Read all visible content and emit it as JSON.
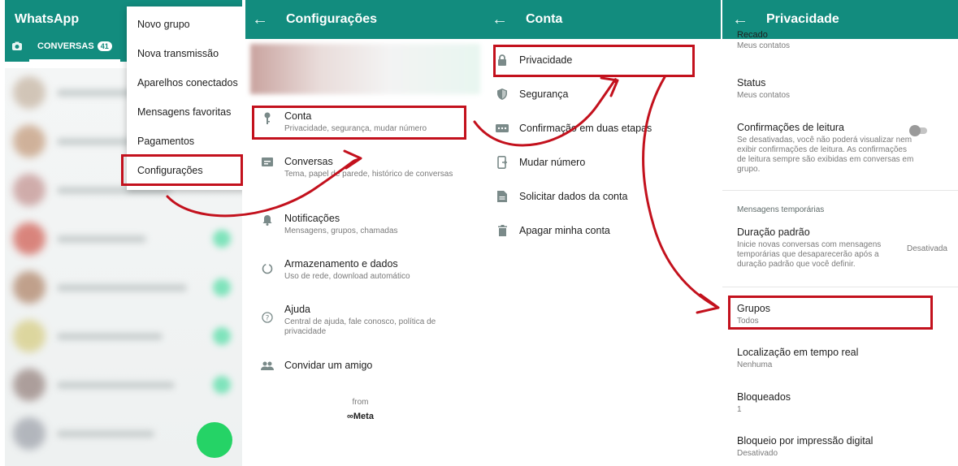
{
  "panel_chats": {
    "app_title": "WhatsApp",
    "tab_label": "CONVERSAS",
    "tab_badge": "41",
    "menu_items": [
      "Novo grupo",
      "Nova transmissão",
      "Aparelhos conectados",
      "Mensagens favoritas",
      "Pagamentos",
      "Configurações"
    ],
    "brand_color": "#128c7e"
  },
  "panel_settings": {
    "title": "Configurações",
    "items": [
      {
        "title": "Conta",
        "subtitle": "Privacidade, segurança, mudar número",
        "icon": "key-icon"
      },
      {
        "title": "Conversas",
        "subtitle": "Tema, papel de parede, histórico de conversas",
        "icon": "chat-icon"
      },
      {
        "title": "Notificações",
        "subtitle": "Mensagens, grupos, chamadas",
        "icon": "bell-icon"
      },
      {
        "title": "Armazenamento e dados",
        "subtitle": "Uso de rede, download automático",
        "icon": "storage-icon"
      },
      {
        "title": "Ajuda",
        "subtitle": "Central de ajuda, fale conosco, política de privacidade",
        "icon": "help-icon"
      },
      {
        "title": "Convidar um amigo",
        "subtitle": "",
        "icon": "people-icon"
      }
    ],
    "from_label": "from",
    "meta_label": "∞Meta"
  },
  "panel_account": {
    "title": "Conta",
    "items": [
      {
        "title": "Privacidade",
        "icon": "lock-icon"
      },
      {
        "title": "Segurança",
        "icon": "shield-icon"
      },
      {
        "title": "Confirmação em duas etapas",
        "icon": "dots-icon"
      },
      {
        "title": "Mudar número",
        "icon": "phone-swap-icon"
      },
      {
        "title": "Solicitar dados da conta",
        "icon": "document-icon"
      },
      {
        "title": "Apagar minha conta",
        "icon": "trash-icon"
      }
    ]
  },
  "panel_privacy": {
    "title": "Privacidade",
    "recado_title": "Recado",
    "recado_value": "Meus contatos",
    "status_title": "Status",
    "status_value": "Meus contatos",
    "read_title": "Confirmações de leitura",
    "read_sub": "Se desativadas, você não poderá visualizar nem exibir confirmações de leitura. As confirmações de leitura sempre são exibidas em conversas em grupo.",
    "temp_section": "Mensagens temporárias",
    "duration_title": "Duração padrão",
    "duration_sub": "Inicie novas conversas com mensagens temporárias que desaparecerão após a duração padrão que você definir.",
    "duration_value": "Desativada",
    "groups_title": "Grupos",
    "groups_value": "Todos",
    "location_title": "Localização em tempo real",
    "location_value": "Nenhuma",
    "blocked_title": "Bloqueados",
    "blocked_value": "1",
    "fingerprint_title": "Bloqueio por impressão digital",
    "fingerprint_value": "Desativado"
  },
  "highlight_color": "#c3111d"
}
